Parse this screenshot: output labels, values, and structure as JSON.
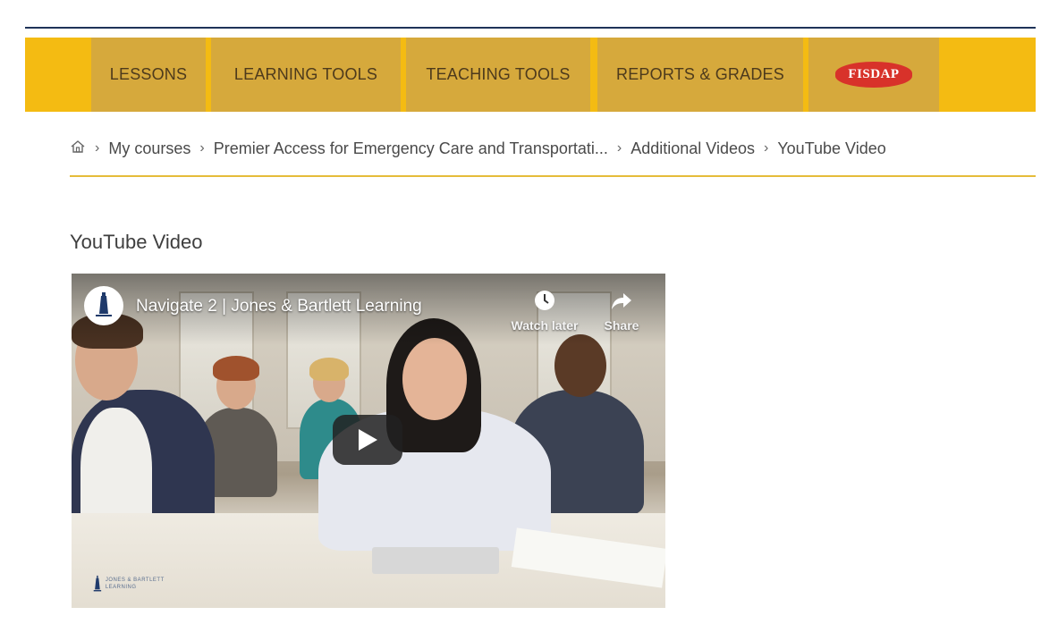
{
  "nav": {
    "items": [
      {
        "label": "LESSONS"
      },
      {
        "label": "LEARNING TOOLS"
      },
      {
        "label": "TEACHING TOOLS"
      },
      {
        "label": "REPORTS & GRADES"
      }
    ],
    "logo_text": "FISDAP",
    "colors": {
      "bar": "#f4bb12",
      "item": "#d6a93c",
      "rule": "#1f3358"
    }
  },
  "breadcrumb": {
    "home_icon": "home-icon",
    "items": [
      {
        "label": "My courses"
      },
      {
        "label": "Premier Access for Emergency Care and Transportati..."
      },
      {
        "label": "Additional Videos"
      },
      {
        "label": "YouTube Video"
      }
    ]
  },
  "page": {
    "title": "YouTube Video"
  },
  "video": {
    "title": "Navigate 2 | Jones & Bartlett Learning",
    "watch_later_label": "Watch later",
    "share_label": "Share",
    "watermark": "JONES & BARTLETT LEARNING"
  }
}
